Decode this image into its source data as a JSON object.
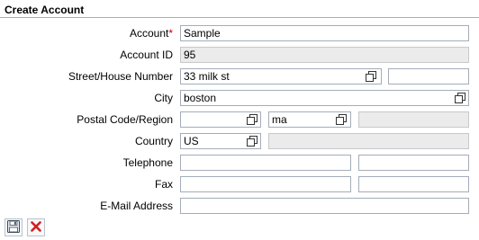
{
  "form": {
    "title": "Create Account"
  },
  "fields": {
    "account": {
      "label": "Account",
      "required_marker": "*",
      "value": "Sample"
    },
    "account_id": {
      "label": "Account ID",
      "value": "95"
    },
    "street": {
      "label": "Street/House Number",
      "street_value": "33 milk st",
      "house_value": ""
    },
    "city": {
      "label": "City",
      "value": "boston"
    },
    "postal": {
      "label": "Postal Code/Region",
      "postal_value": "",
      "region_value": "ma",
      "region_desc": ""
    },
    "country": {
      "label": "Country",
      "value": "US",
      "country_desc": ""
    },
    "telephone": {
      "label": "Telephone",
      "value": "",
      "extension": ""
    },
    "fax": {
      "label": "Fax",
      "value": "",
      "extension": ""
    },
    "email": {
      "label": "E-Mail Address",
      "value": ""
    }
  },
  "toolbar": {
    "save_icon": "floppy-disk-icon",
    "cancel_icon": "red-x-icon",
    "cancel_color": "#d42020"
  },
  "colors": {
    "title_rule": "#9fb0c2",
    "readonly_bg": "#ebebeb",
    "required": "#c00000"
  }
}
